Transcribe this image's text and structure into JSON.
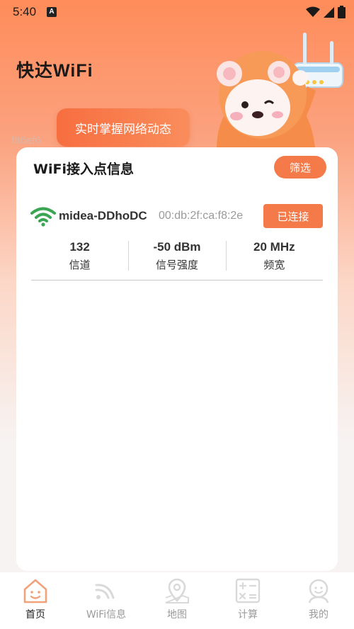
{
  "status_bar": {
    "time": "5:40",
    "notification_icon": "a-icon",
    "right_icons": [
      "wifi-icon",
      "signal-icon",
      "battery-icon"
    ]
  },
  "header": {
    "title": "快达WiFi",
    "ghost_hex": "f86ef6",
    "banner_text": "实时掌握网络动态"
  },
  "card": {
    "title": "WiFi接入点信息",
    "filter_label": "筛选",
    "access_point": {
      "ssid": "midea-DDhoDC",
      "bssid": "00:db:2f:ca:f8:2e",
      "status": "已连接",
      "channel_value": "132",
      "channel_label": "信道",
      "signal_value": "-50 dBm",
      "signal_label": "信号强度",
      "bandwidth_value": "20 MHz",
      "bandwidth_label": "频宽"
    }
  },
  "tabbar": {
    "tabs": [
      {
        "label": "首页",
        "icon": "home-icon",
        "active": true
      },
      {
        "label": "WiFi信息",
        "icon": "wifi-icon",
        "active": false
      },
      {
        "label": "地图",
        "icon": "map-pin-icon",
        "active": false
      },
      {
        "label": "计算",
        "icon": "calculator-icon",
        "active": false
      },
      {
        "label": "我的",
        "icon": "profile-icon",
        "active": false
      }
    ]
  },
  "colors": {
    "accent": "#f47a4a",
    "wifi_green": "#3aa552",
    "tab_active_icon": "#f2a27a",
    "tab_inactive_icon": "#d9d9d9"
  }
}
